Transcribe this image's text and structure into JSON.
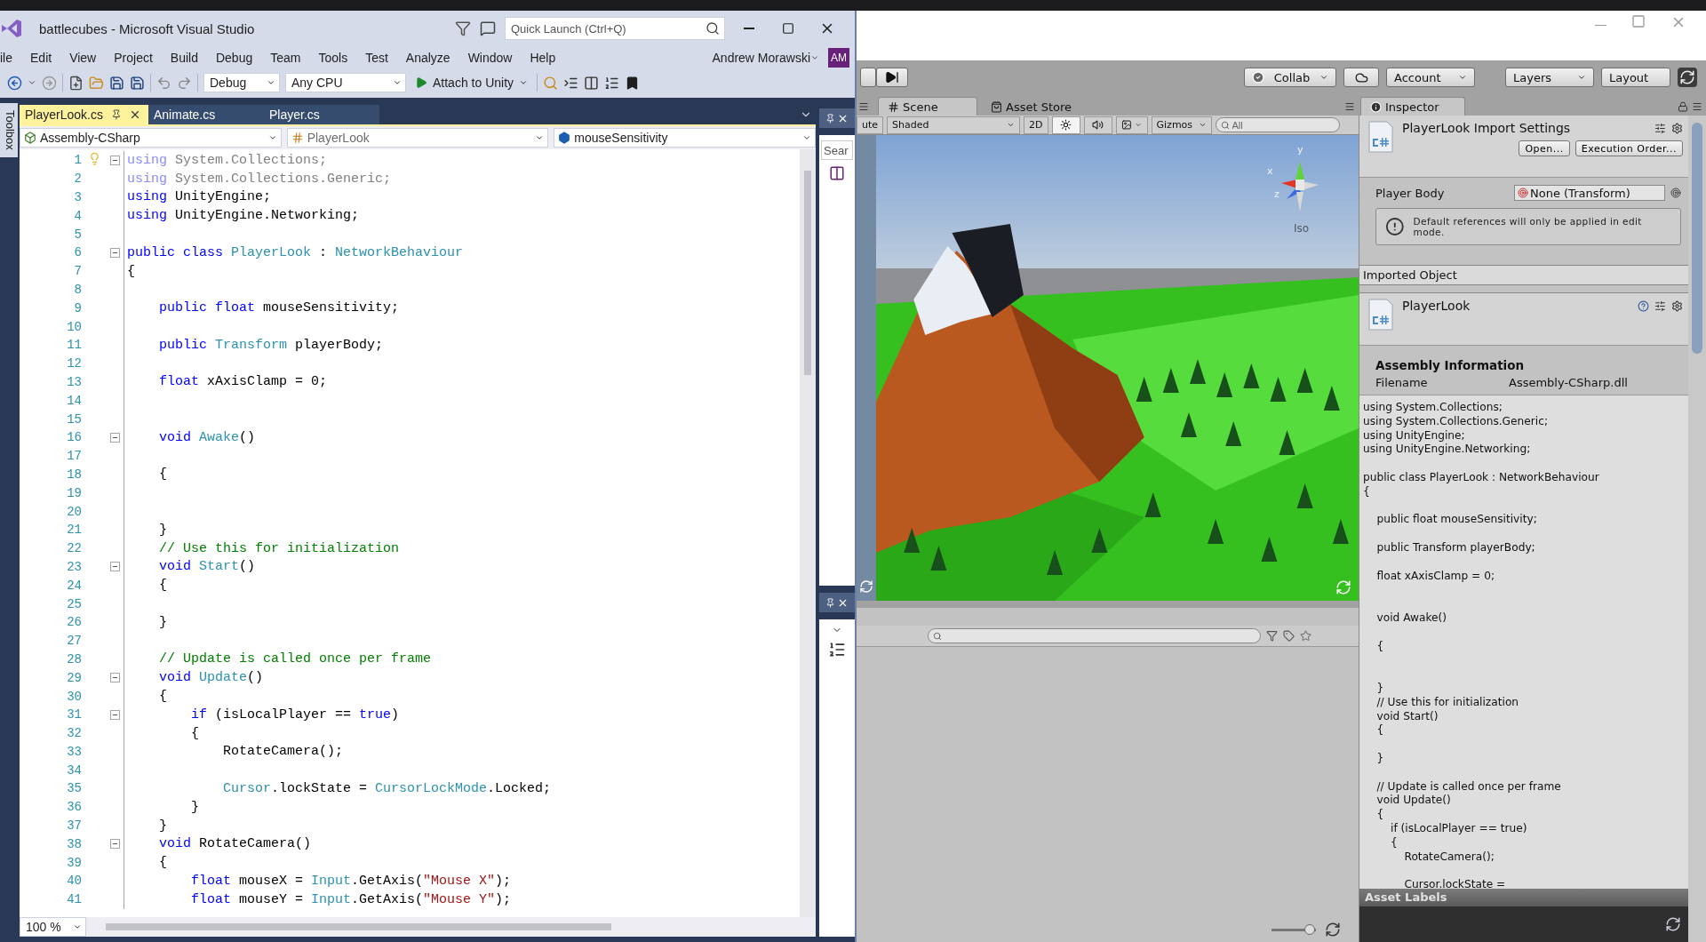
{
  "vs": {
    "title": "battlecubes - Microsoft Visual Studio",
    "quick_launch": {
      "placeholder": "Quick Launch (Ctrl+Q)"
    },
    "menu": [
      "ile",
      "Edit",
      "View",
      "Project",
      "Build",
      "Debug",
      "Team",
      "Tools",
      "Test",
      "Analyze",
      "Window",
      "Help"
    ],
    "user": {
      "name": "Andrew Morawski",
      "initials": "AM"
    },
    "toolbar": {
      "configuration": "Debug",
      "platform": "Any CPU",
      "run": "Attach to Unity"
    },
    "toolbox_label": "Toolbox",
    "tabs": [
      {
        "label": "PlayerLook.cs",
        "selected": true
      },
      {
        "label": "Animate.cs",
        "selected": false
      },
      {
        "label": "Player.cs",
        "selected": false
      }
    ],
    "nav": [
      "Assembly-CSharp",
      "PlayerLook",
      "mouseSensitivity"
    ],
    "lines": [
      {
        "number": "1",
        "fold": true,
        "lightbulb": true,
        "tokens": [
          {
            "kind": "unused_kw",
            "text": "using"
          },
          {
            "kind": "unused",
            "text": " System.Collections;"
          }
        ]
      },
      {
        "number": "2",
        "fold": false,
        "lightbulb": false,
        "tokens": [
          {
            "kind": "unused_kw",
            "text": "using"
          },
          {
            "kind": "unused",
            "text": " System.Collections.Generic;"
          }
        ]
      },
      {
        "number": "3",
        "fold": false,
        "lightbulb": false,
        "tokens": [
          {
            "kind": "kw",
            "text": "using"
          },
          {
            "kind": "plain",
            "text": " UnityEngine;"
          }
        ]
      },
      {
        "number": "4",
        "fold": false,
        "lightbulb": false,
        "tokens": [
          {
            "kind": "kw",
            "text": "using"
          },
          {
            "kind": "plain",
            "text": " UnityEngine.Networking;"
          }
        ]
      },
      {
        "number": "5",
        "fold": false,
        "lightbulb": false
      },
      {
        "number": "6",
        "fold": true,
        "lightbulb": false,
        "tokens": [
          {
            "kind": "kw",
            "text": "public class"
          },
          {
            "kind": "type",
            "text": " PlayerLook"
          },
          {
            "kind": "plain",
            "text": " : "
          },
          {
            "kind": "type",
            "text": "NetworkBehaviour"
          }
        ]
      },
      {
        "number": "7",
        "fold": false,
        "lightbulb": false,
        "tokens": [
          {
            "kind": "plain",
            "text": "{"
          }
        ]
      },
      {
        "number": "8",
        "fold": false,
        "lightbulb": false
      },
      {
        "number": "9",
        "fold": false,
        "lightbulb": false,
        "tokens": [
          {
            "kind": "kw",
            "text": "    public float"
          },
          {
            "kind": "plain",
            "text": " mouseSensitivity;"
          }
        ]
      },
      {
        "number": "10",
        "fold": false,
        "lightbulb": false
      },
      {
        "number": "11",
        "fold": false,
        "lightbulb": false,
        "tokens": [
          {
            "kind": "kw",
            "text": "    public"
          },
          {
            "kind": "type",
            "text": " Transform"
          },
          {
            "kind": "plain",
            "text": " playerBody;"
          }
        ]
      },
      {
        "number": "12",
        "fold": false,
        "lightbulb": false
      },
      {
        "number": "13",
        "fold": false,
        "lightbulb": false,
        "tokens": [
          {
            "kind": "kw",
            "text": "    float"
          },
          {
            "kind": "plain",
            "text": " xAxisClamp = 0;"
          }
        ]
      },
      {
        "number": "14",
        "fold": false,
        "lightbulb": false
      },
      {
        "number": "15",
        "fold": false,
        "lightbulb": false
      },
      {
        "number": "16",
        "fold": true,
        "lightbulb": false,
        "tokens": [
          {
            "kind": "kw",
            "text": "    void"
          },
          {
            "kind": "type",
            "text": " Awake"
          },
          {
            "kind": "plain",
            "text": "()"
          }
        ]
      },
      {
        "number": "17",
        "fold": false,
        "lightbulb": false
      },
      {
        "number": "18",
        "fold": false,
        "lightbulb": false,
        "tokens": [
          {
            "kind": "plain",
            "text": "    {"
          }
        ]
      },
      {
        "number": "19",
        "fold": false,
        "lightbulb": false
      },
      {
        "number": "20",
        "fold": false,
        "lightbulb": false
      },
      {
        "number": "21",
        "fold": false,
        "lightbulb": false,
        "tokens": [
          {
            "kind": "plain",
            "text": "    }"
          }
        ]
      },
      {
        "number": "22",
        "fold": false,
        "lightbulb": false,
        "tokens": [
          {
            "kind": "comment",
            "text": "    // Use this for initialization"
          }
        ]
      },
      {
        "number": "23",
        "fold": true,
        "lightbulb": false,
        "tokens": [
          {
            "kind": "kw",
            "text": "    void"
          },
          {
            "kind": "type",
            "text": " Start"
          },
          {
            "kind": "plain",
            "text": "()"
          }
        ]
      },
      {
        "number": "24",
        "fold": false,
        "lightbulb": false,
        "tokens": [
          {
            "kind": "plain",
            "text": "    {"
          }
        ]
      },
      {
        "number": "25",
        "fold": false,
        "lightbulb": false
      },
      {
        "number": "26",
        "fold": false,
        "lightbulb": false,
        "tokens": [
          {
            "kind": "plain",
            "text": "    }"
          }
        ]
      },
      {
        "number": "27",
        "fold": false,
        "lightbulb": false
      },
      {
        "number": "28",
        "fold": false,
        "lightbulb": false,
        "tokens": [
          {
            "kind": "comment",
            "text": "    // Update is called once per frame"
          }
        ]
      },
      {
        "number": "29",
        "fold": true,
        "lightbulb": false,
        "tokens": [
          {
            "kind": "kw",
            "text": "    void"
          },
          {
            "kind": "type",
            "text": " Update"
          },
          {
            "kind": "plain",
            "text": "()"
          }
        ]
      },
      {
        "number": "30",
        "fold": false,
        "lightbulb": false,
        "tokens": [
          {
            "kind": "plain",
            "text": "    {"
          }
        ]
      },
      {
        "number": "31",
        "fold": true,
        "lightbulb": false,
        "tokens": [
          {
            "kind": "kw",
            "text": "        if"
          },
          {
            "kind": "plain",
            "text": " (isLocalPlayer == "
          },
          {
            "kind": "kw",
            "text": "true"
          },
          {
            "kind": "plain",
            "text": ")"
          }
        ]
      },
      {
        "number": "32",
        "fold": false,
        "lightbulb": false,
        "tokens": [
          {
            "kind": "plain",
            "text": "        {"
          }
        ]
      },
      {
        "number": "33",
        "fold": false,
        "lightbulb": false,
        "tokens": [
          {
            "kind": "plain",
            "text": "            RotateCamera();"
          }
        ]
      },
      {
        "number": "34",
        "fold": false,
        "lightbulb": false
      },
      {
        "number": "35",
        "fold": false,
        "lightbulb": false,
        "tokens": [
          {
            "kind": "type",
            "text": "            Cursor"
          },
          {
            "kind": "plain",
            "text": ".lockState = "
          },
          {
            "kind": "type",
            "text": "CursorLockMode"
          },
          {
            "kind": "plain",
            "text": ".Locked;"
          }
        ]
      },
      {
        "number": "36",
        "fold": false,
        "lightbulb": false,
        "tokens": [
          {
            "kind": "plain",
            "text": "        }"
          }
        ]
      },
      {
        "number": "37",
        "fold": false,
        "lightbulb": false,
        "tokens": [
          {
            "kind": "plain",
            "text": "    }"
          }
        ]
      },
      {
        "number": "38",
        "fold": true,
        "lightbulb": false,
        "tokens": [
          {
            "kind": "kw",
            "text": "    void"
          },
          {
            "kind": "plain",
            "text": " RotateCamera()"
          }
        ]
      },
      {
        "number": "39",
        "fold": false,
        "lightbulb": false,
        "tokens": [
          {
            "kind": "plain",
            "text": "    {"
          }
        ]
      },
      {
        "number": "40",
        "fold": false,
        "lightbulb": false,
        "tokens": [
          {
            "kind": "kw",
            "text": "        float"
          },
          {
            "kind": "plain",
            "text": " mouseX = "
          },
          {
            "kind": "type",
            "text": "Input"
          },
          {
            "kind": "plain",
            "text": ".GetAxis("
          },
          {
            "kind": "string",
            "text": "\"Mouse X\""
          },
          {
            "kind": "plain",
            "text": ");"
          }
        ]
      },
      {
        "number": "41",
        "fold": false,
        "lightbulb": false,
        "tokens": [
          {
            "kind": "kw",
            "text": "        float"
          },
          {
            "kind": "plain",
            "text": " mouseY = "
          },
          {
            "kind": "type",
            "text": "Input"
          },
          {
            "kind": "plain",
            "text": ".GetAxis("
          },
          {
            "kind": "string",
            "text": "\"Mouse Y\""
          },
          {
            "kind": "plain",
            "text": ");"
          }
        ]
      }
    ],
    "zoom": "100 %",
    "side_panel": {
      "search_placeholder": "Sear"
    }
  },
  "unity": {
    "toolbar": {
      "collab": "Collab",
      "account": "Account",
      "layers": "Layers",
      "layout": "Layout"
    },
    "scene_tabs": [
      {
        "label": "Scene",
        "selected": true
      },
      {
        "label": "Asset Store",
        "selected": false
      }
    ],
    "scene_toolbar": {
      "cut_button": "ute",
      "shading": "Shaded",
      "mode_2d": "2D",
      "lighting_on": true,
      "audio_on": false,
      "effects_on": false,
      "gizmos": "Gizmos",
      "search_placeholder": "All"
    },
    "gizmo": {
      "axes": [
        "y",
        "x",
        "z"
      ],
      "projection": "Iso"
    },
    "project": {
      "size_slider": {
        "level": 0.85
      }
    },
    "inspector": {
      "tab": "Inspector",
      "title": "PlayerLook Import Settings",
      "buttons": [
        "Open...",
        "Execution Order..."
      ],
      "field": {
        "label": "Player Body",
        "value": "None (Transform)"
      },
      "help": "Default references will only be applied in edit mode.",
      "section": "Imported Object",
      "asset_name": "PlayerLook",
      "info_title": "Assembly Information",
      "info": {
        "label": "Filename",
        "value": "Assembly-CSharp.dll"
      },
      "preview": "using System.Collections;\nusing System.Collections.Generic;\nusing UnityEngine;\nusing UnityEngine.Networking;\n\npublic class PlayerLook : NetworkBehaviour\n{\n\n    public float mouseSensitivity;\n\n    public Transform playerBody;\n\n    float xAxisClamp = 0;\n\n\n    void Awake()\n\n    {\n\n\n    }\n    // Use this for initialization\n    void Start()\n    {\n\n    }\n\n    // Update is called once per frame\n    void Update()\n    {\n        if (isLocalPlayer == true)\n        {\n            RotateCamera();\n\n            Cursor.lockState =",
      "labels_bar": "Asset Labels"
    }
  }
}
